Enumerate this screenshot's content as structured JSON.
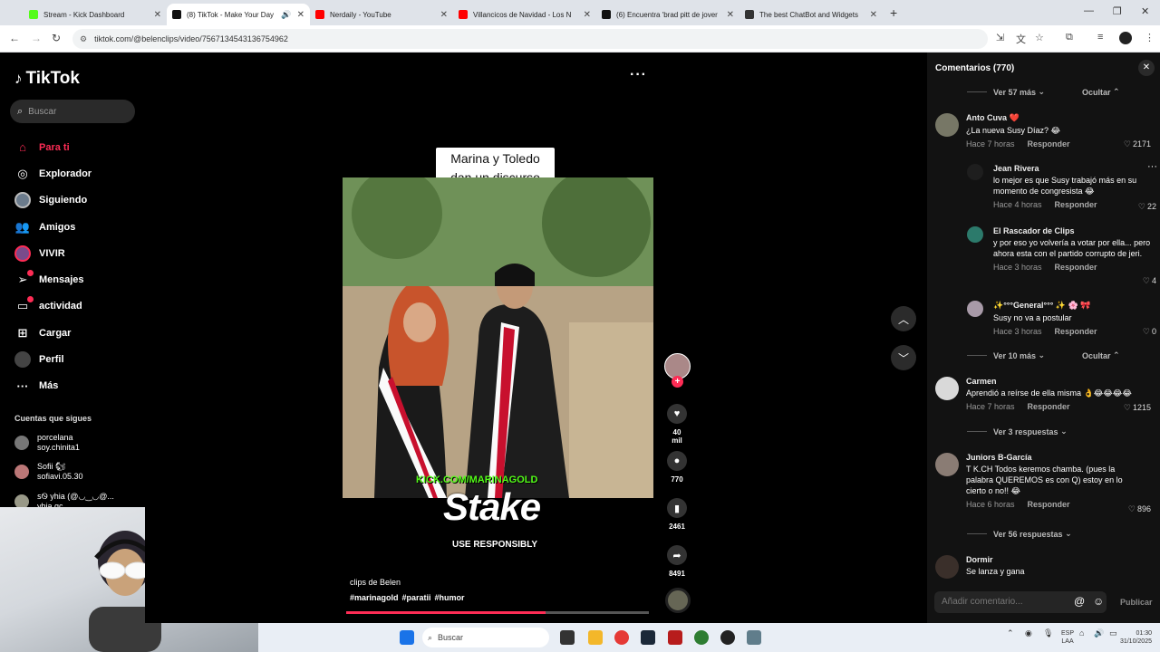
{
  "browser": {
    "tabs": [
      {
        "title": "Stream - Kick Dashboard",
        "color": "#53fc18"
      },
      {
        "title": "(8) TikTok - Make Your Day",
        "color": "#111111",
        "active": true
      },
      {
        "title": "Nerdaily - YouTube",
        "color": "#ff0000"
      },
      {
        "title": "Villancicos de Navidad - Los N",
        "color": "#ff0000"
      },
      {
        "title": "(6) Encuentra 'brad pitt de jover",
        "color": "#111111"
      },
      {
        "title": "The best ChatBot and Widgets",
        "color": "#333333"
      }
    ],
    "url": "tiktok.com/@belenclips/video/7567134543136754962"
  },
  "sidebar": {
    "logo": "TikTok",
    "search_placeholder": "Buscar",
    "nav": [
      {
        "label": "Para ti",
        "icon": "home-icon",
        "active": true
      },
      {
        "label": "Explorador",
        "icon": "compass-icon"
      },
      {
        "label": "Siguiendo",
        "icon": "following-icon"
      },
      {
        "label": "Amigos",
        "icon": "friends-icon"
      },
      {
        "label": "VIVIR",
        "icon": "live-icon"
      },
      {
        "label": "Mensajes",
        "icon": "messages-icon",
        "badge": true
      },
      {
        "label": "actividad",
        "icon": "activity-icon",
        "badge": true
      },
      {
        "label": "Cargar",
        "icon": "upload-icon"
      },
      {
        "label": "Perfil",
        "icon": "profile-icon"
      },
      {
        "label": "Más",
        "icon": "more-icon"
      }
    ],
    "following_header": "Cuentas que sigues",
    "following": [
      {
        "name": "porcelana",
        "handle": "soy.chinita1"
      },
      {
        "name": "Sofii 🐿",
        "handle": "sofiavi.05.30"
      },
      {
        "name": "ꜱᏫ yhia (@◡‿◡@...",
        "handle": "yhia.gc"
      }
    ]
  },
  "video": {
    "caption_line1": "Marina y Toledo",
    "caption_line2": "dan un discurso",
    "kick_overlay": "KICK.COM/MARINAGOLD",
    "stake_logo": "Stake",
    "responsibly": "USE RESPONSIBLY",
    "author": "clips de Belen",
    "hashtags": [
      "#marinagold",
      "#paratii",
      "#humor"
    ],
    "progress": 0.66,
    "likes": "40 mil",
    "comments": "770",
    "saves": "2461",
    "shares": "8491"
  },
  "comments": {
    "header": "Comentarios (770)",
    "see_more_top": "Ver 57 más",
    "hide_label": "Ocultar",
    "see_more_mid": "Ver 10 más",
    "reply_label": "Responder",
    "items": [
      {
        "name": "Anto Cuva ❤️",
        "text": "¿La nueva Susy Díaz? 😂",
        "time": "Hace 7 horas",
        "likes": "2171"
      },
      {
        "name": "Jean Rivera",
        "text": "lo mejor es que Susy trabajó más en su momento de congresista 😂",
        "time": "Hace 4 horas",
        "likes": "22"
      },
      {
        "name": "El Rascador de Clips",
        "text": "y por eso yo volvería a votar por ella... pero ahora esta con el partido corrupto de jeri.",
        "time": "Hace 3 horas",
        "likes": "4"
      },
      {
        "name": "✨°°°General°°° ✨ 🌸 🎀",
        "text": "Susy no va a postular",
        "time": "Hace 3 horas",
        "likes": "0"
      },
      {
        "name": "Carmen",
        "text": "Aprendió a reírse de ella misma 👌😂😂😂😂",
        "time": "Hace 7 horas",
        "likes": "1215"
      },
      {
        "name": "Juniors B-García",
        "text": "T K.CH Todos keremos chamba. (pues la palabra QUEREMOS es con Q) estoy en lo cierto o no!! 😂",
        "time": "Hace 6 horas",
        "likes": "896"
      },
      {
        "name": "Dormir",
        "text": "Se lanza y gana",
        "time": "",
        "likes": ""
      }
    ],
    "see_replies_carmen": "Ver 3 respuestas",
    "see_replies_juniors": "Ver 56 respuestas",
    "input_placeholder": "Añadir comentario...",
    "publish": "Publicar"
  },
  "taskbar": {
    "search": "Buscar",
    "lang1": "ESP",
    "lang2": "LAA",
    "time": "01:30",
    "date": "31/10/2025"
  }
}
